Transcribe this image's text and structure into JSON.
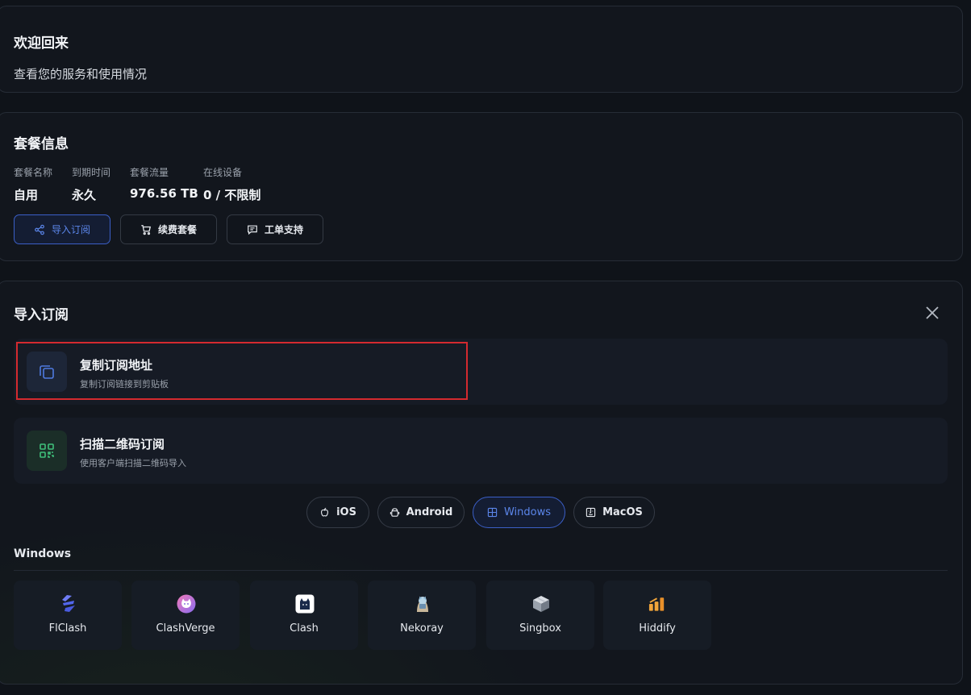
{
  "welcome": {
    "title": "欢迎回来",
    "subtitle": "查看您的服务和使用情况"
  },
  "plan": {
    "title": "套餐信息",
    "stats": [
      {
        "label": "套餐名称",
        "value": "自用"
      },
      {
        "label": "到期时间",
        "value": "永久"
      },
      {
        "label": "套餐流量",
        "value": "976.56 TB"
      },
      {
        "label": "在线设备",
        "value": "0 / 不限制"
      }
    ],
    "buttons": {
      "import": "导入订阅",
      "renew": "续费套餐",
      "ticket": "工单支持"
    }
  },
  "import_panel": {
    "title": "导入订阅",
    "options": [
      {
        "title": "复制订阅地址",
        "desc": "复制订阅链接到剪贴板",
        "icon": "copy-icon"
      },
      {
        "title": "扫描二维码订阅",
        "desc": "使用客户端扫描二维码导入",
        "icon": "qr-code-icon"
      }
    ],
    "os_tabs": [
      {
        "label": "iOS",
        "icon": "apple-icon"
      },
      {
        "label": "Android",
        "icon": "android-icon"
      },
      {
        "label": "Windows",
        "icon": "windows-icon",
        "active": true
      },
      {
        "label": "MacOS",
        "icon": "finder-icon"
      }
    ],
    "section_label": "Windows",
    "clients": [
      {
        "name": "FlClash",
        "icon": "flclash-icon"
      },
      {
        "name": "ClashVerge",
        "icon": "clashverge-icon"
      },
      {
        "name": "Clash",
        "icon": "clash-icon"
      },
      {
        "name": "Nekoray",
        "icon": "nekoray-icon"
      },
      {
        "name": "Singbox",
        "icon": "singbox-icon"
      },
      {
        "name": "Hiddify",
        "icon": "hiddify-icon"
      }
    ]
  },
  "colors": {
    "background": "#0f1319",
    "card": "#12161d",
    "accent": "#3b5fc7",
    "highlight": "#d42a2f"
  }
}
